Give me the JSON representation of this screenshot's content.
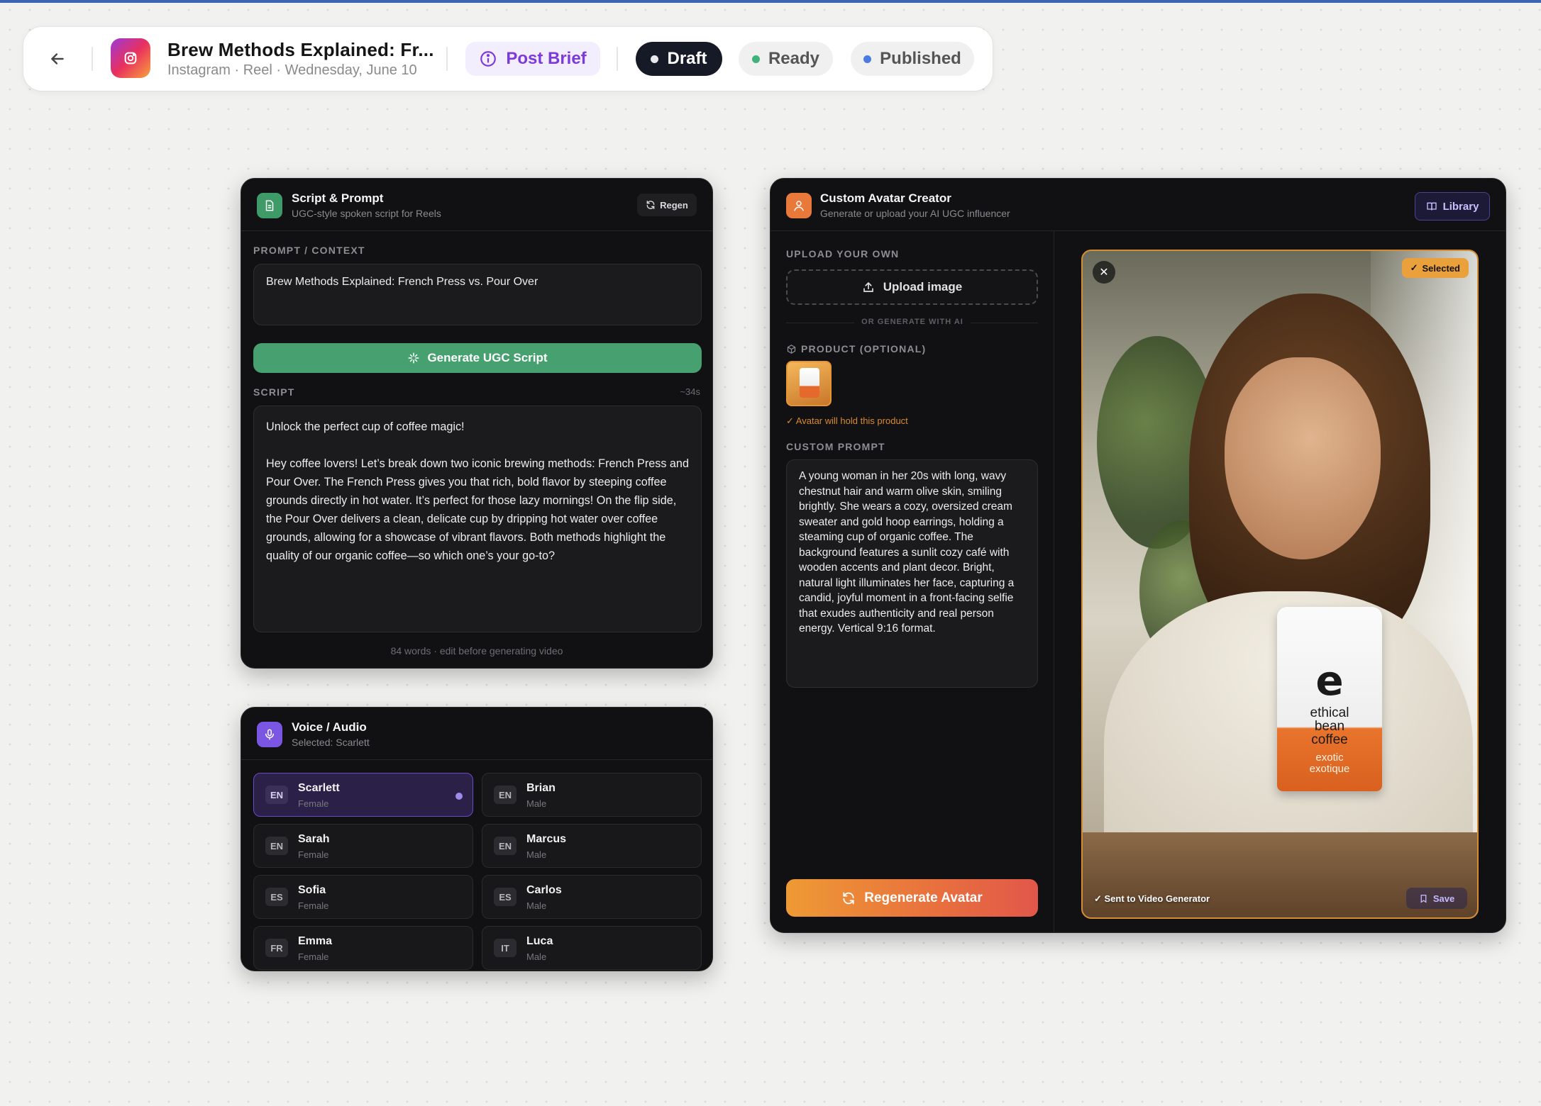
{
  "header": {
    "title": "Brew Methods Explained: Fr...",
    "subtitle": "Instagram · Reel · Wednesday, June 10",
    "post_brief_label": "Post Brief",
    "statuses": [
      {
        "label": "Draft",
        "color": "#e9e9ec"
      },
      {
        "label": "Ready",
        "color": "#3fb37a"
      },
      {
        "label": "Published",
        "color": "#4a7be2"
      }
    ]
  },
  "script_card": {
    "title": "Script & Prompt",
    "subtitle": "UGC-style spoken script for Reels",
    "regen_label": "Regen",
    "prompt_label": "PROMPT / CONTEXT",
    "prompt_value": "Brew Methods Explained: French Press vs. Pour Over",
    "generate_label": "Generate UGC Script",
    "script_label": "SCRIPT",
    "duration": "~34s",
    "script_text": "Unlock the perfect cup of coffee magic!\n\nHey coffee lovers! Let’s break down two iconic brewing methods: French Press and Pour Over. The French Press gives you that rich, bold flavor by steeping coffee grounds directly in hot water. It’s perfect for those lazy mornings! On the flip side, the Pour Over delivers a clean, delicate cup by dripping hot water over coffee grounds, allowing for a showcase of vibrant flavors. Both methods highlight the quality of our organic coffee—so which one’s your go-to?",
    "word_count": "84 words · edit before generating video"
  },
  "voice_card": {
    "title": "Voice / Audio",
    "subtitle": "Selected: Scarlett",
    "voices": [
      {
        "lang": "EN",
        "name": "Scarlett",
        "gender": "Female"
      },
      {
        "lang": "EN",
        "name": "Brian",
        "gender": "Male"
      },
      {
        "lang": "EN",
        "name": "Sarah",
        "gender": "Female"
      },
      {
        "lang": "EN",
        "name": "Marcus",
        "gender": "Male"
      },
      {
        "lang": "ES",
        "name": "Sofia",
        "gender": "Female"
      },
      {
        "lang": "ES",
        "name": "Carlos",
        "gender": "Male"
      },
      {
        "lang": "FR",
        "name": "Emma",
        "gender": "Female"
      },
      {
        "lang": "IT",
        "name": "Luca",
        "gender": "Male"
      }
    ]
  },
  "avatar_card": {
    "title": "Custom Avatar Creator",
    "subtitle": "Generate or upload your AI UGC influencer",
    "library_label": "Library",
    "upload_label": "UPLOAD YOUR OWN",
    "upload_button": "Upload image",
    "or_generate": "OR GENERATE WITH AI",
    "product_label": "PRODUCT (OPTIONAL)",
    "hold_text": "✓ Avatar will hold this product",
    "custom_prompt_label": "CUSTOM PROMPT",
    "custom_prompt": "A young woman in her 20s with long, wavy chestnut hair and warm olive skin, smiling brightly. She wears a cozy, oversized cream sweater and gold hoop earrings, holding a steaming cup of organic coffee. The background features a sunlit cozy café with wooden accents and plant decor. Bright, natural light illuminates her face, capturing a candid, joyful moment in a front-facing selfie that exudes authenticity and real person energy. Vertical 9:16 format.",
    "regenerate_label": "Regenerate Avatar",
    "selected_badge": "Selected",
    "sent_text": "✓ Sent to Video Generator",
    "save_label": "Save",
    "bag_logo": "e",
    "bag_brand": [
      "ethical",
      "bean",
      "coffee"
    ],
    "bag_flavor": [
      "exotic",
      "exotique"
    ]
  }
}
